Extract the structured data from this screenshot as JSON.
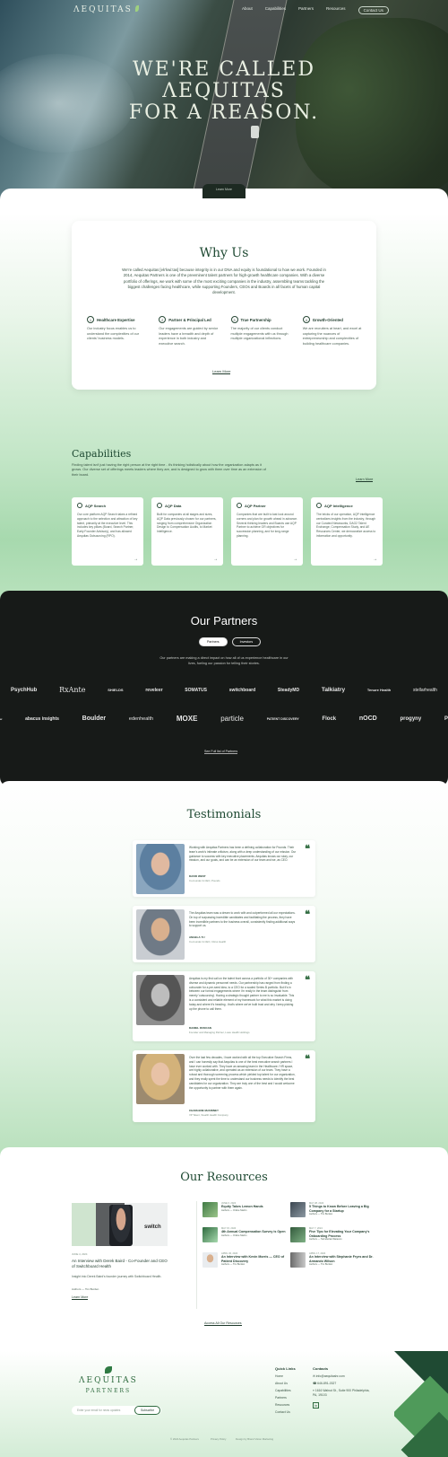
{
  "nav": {
    "logo": "ΛEQUITAS",
    "links": [
      "About",
      "Capabilities",
      "Partners",
      "Resources"
    ],
    "cta": "Contact Us"
  },
  "hero": {
    "title_line1": "WE'RE CALLED",
    "title_line2": "ΛEQUITAS",
    "title_line3": "FOR A REASON.",
    "learn_more": "Learn More"
  },
  "why": {
    "title": "Why Us",
    "text": "We're called Aequitas [ek'kwi:tas] because integrity is in our DNA and equity is foundational to how we work. Founded in 2014, Aequitas Partners is one of the preeminent talent partners for high-growth healthcare companies. With a diverse portfolio of offerings, we work with some of the most exciting companies in the industry, assembling teams tackling the biggest challenges facing healthcare, while supporting Founders, CEOs and Boards in all facets of human capital development.",
    "pillars": [
      {
        "num": "1",
        "title": "Healthcare Expertise",
        "desc": "Our industry focus enables us to understand the complexities of our clients' business models."
      },
      {
        "num": "2",
        "title": "Partner & Principal Led",
        "desc": "Our engagements are guided by senior leaders have a breadth and depth of experience in both industry and executive search."
      },
      {
        "num": "3",
        "title": "True Partnership",
        "desc": "The majority of our clients conduct multiple engagements with us through multiple organizational inflections."
      },
      {
        "num": "4",
        "title": "Growth-Oriented",
        "desc": "We are recruiters at heart, and excel at capturing the nuances of entrepreneurship and complexities of building healthcare companies."
      }
    ],
    "button": "Learn More"
  },
  "capabilities": {
    "title": "Capabilities",
    "text": "Finding talent isn't just having the right person at the right time - it's thinking holistically about how the organization adapts as it grows. Our diverse set of offerings meets leaders where they are, and is designed to grow with them over time as an extension of their board.",
    "button": "Learn More",
    "cards": [
      {
        "title": "AQP Search",
        "desc": "Our core platform AQP Search takes a refined approach to the selection and attraction of key talent, primarily at the executive level. This includes key pillars (Board, Search Partner, Early Founder Advisory), and has allowed Aequitas Outsourcing (RPO)."
      },
      {
        "title": "AQP Data",
        "desc": "Built for companies at all stages and sizes, AQP Data previously chosen for our partners, ranging from comprehensive Organization Design to Compensation Audits, to Market Intelligence."
      },
      {
        "title": "AQP Partner",
        "desc": "Companies that are built to last look around corners and plan for growth ahead in advance. Several thinking leaders and Boards use AQP Partner to achieve OR objectives for succession planning, and for long-range planning."
      },
      {
        "title": "AQP Intelligence",
        "desc": "The bricks of our operation, AQP Intelligence centralizes insights from the industry, through our Curated Newsworks, DAO2 Talent Exchange, Compensation Study, and AE Resources Center, we democratize access to information and opportunity."
      }
    ]
  },
  "partners": {
    "title": "Our Partners",
    "tabs": [
      "Partners",
      "Investors"
    ],
    "text": "Our partners are making a direct impact on how all of us experience healthcare in our lives, fueling our passion for telling their stories.",
    "row1": [
      "PsychHub",
      "RxAnte",
      "SHIELDS",
      "reveleer",
      "SOMATUS",
      "switchboard",
      "SteadyMD",
      "Talkiatry",
      "Tenure Health",
      "stellarhealth"
    ],
    "row2": [
      "w",
      "abacus insights",
      "Boulder",
      "edenhealth",
      "MOXE",
      "particle",
      "PATIENT DISCOVERY",
      "Flock",
      "nOCD",
      "progyny",
      "P"
    ],
    "button": "See Full list of Partners"
  },
  "testimonials": {
    "title": "Testimonials",
    "items": [
      {
        "text": "Working with Aequitas Partners has been a defining collaboration for Pounds. Their team's work's intimate criticism, along with a deep understanding of our mission. Our guidance to success with key executive placements. Aequitas knows our story, our mission, and our goals, and can be an extension of our team and we, as CEO.",
        "name": "DAVID WEST",
        "role": "Co-founder & CEO, Pounds"
      },
      {
        "text": "The Aequitas team was a dream to work with and outperformed all our expectations. On top of surpassing incredible candidates and facilitating the process, they have been incredible partners to the business overall, consistently finding additional ways to support us.",
        "name": "ANGELA YU",
        "role": "Co-founder & CEO, Citrus Health"
      },
      {
        "text": "Aequitas is my first call on the talent front across a portfolio of 30+ companies with diverse and dynamic personnel needs. Our partnership has ranged from finding a cofounder for a pre-seed idea, to a CEO for a scaled Series B portfolio. But it's in between our formal engagements where I'm really in the team distinguish from merely 'outsourcing'. Having a strategic thought partner to me is so invaluable. This is a consistent and reliable element of my framework for what this market is doing today and where it's heading - that's where we've built trust and why I keep picking up the phone to call them.",
        "name": "DANIEL DUNCAN",
        "role": "Founder and Managing Partner, Lowe Health Holdings"
      },
      {
        "text": "Over the last few decades, I have worked with all the top Executive Search Firms, and I can honestly say that Aequitas is one of the best executive search partners I have ever worked with. They have an amazing team in the Healthcare / HR space, are highly collaborative, and operated as an extension of our team. They have a robust and thorough screening process which yielded top talent for our organization, and they really spent the time to understand our business needs to identify the best candidates for our organization. They are truly one of the best and I would welcome the opportunity to partner with them again.",
        "name": "CHARLENE McKINNEY",
        "role": "VP Talent, Stealth Health Company"
      }
    ]
  },
  "resources": {
    "title": "Our Resources",
    "featured": {
      "image_tag": "switch",
      "date": "JUNE 4, 2024",
      "title": "An Interview with Derek Baird - Co-Founder and CEO of Switchboard Health",
      "desc": "Insight into Derek Baird's founder journey with Switchboard Health.",
      "author": "Authors — Tim Burden",
      "link": "Learn More"
    },
    "items": [
      {
        "date": "JUNE 6, 2024",
        "title": "Equity Takes Lemon Hands",
        "author": "Authors — Online Martin"
      },
      {
        "date": "MAY 28, 2024",
        "title": "5 Things to Know Before Leaving a Big Company for a Startup",
        "author": "Authors — Tim Burden"
      },
      {
        "date": "MAY 15, 2024",
        "title": "4th Annual Compensation Survey is Open",
        "author": "Authors — Online Martin"
      },
      {
        "date": "MAY 7, 2024",
        "title": "Five Tips for Elevating Your Company's Onboarding Process",
        "author": "Authors — Tarinderlak Watanon"
      },
      {
        "date": "APRIL 30, 2024",
        "title": "An Interview with Kevin Morris — CEO of Patient Discovery",
        "author": "Authors — Tim Burden"
      },
      {
        "date": "APRIL 17, 2024",
        "title": "An Interview with Stephanie Fryes and Dr. Armando Wilson",
        "author": "Authors — Tim Burden"
      }
    ],
    "button": "Access All Our Resources"
  },
  "footer": {
    "logo_line1": "ΛEQUITAS",
    "logo_line2": "PARTNERS",
    "input_placeholder": "Enter your email for news updates",
    "subscribe": "Subscribe",
    "quick_links_title": "Quick Links",
    "quick_links": [
      "Home",
      "About Us",
      "Capabilities",
      "Partners",
      "Resources",
      "Contact Us"
    ],
    "contacts_title": "Contacts",
    "contacts": [
      "info@aequitashr.com",
      "646-891-0327",
      "1616 Walnut St., Suite 900 Philadelphia, PA, 19103"
    ],
    "bottom": [
      "© 2024 Aequitas Partners",
      "Privacy Policy",
      "Design by Brand Vision Marketing"
    ]
  },
  "colors": {
    "brand": "#1f4a33",
    "accent": "#4f9a5a",
    "dark": "#171a18"
  }
}
